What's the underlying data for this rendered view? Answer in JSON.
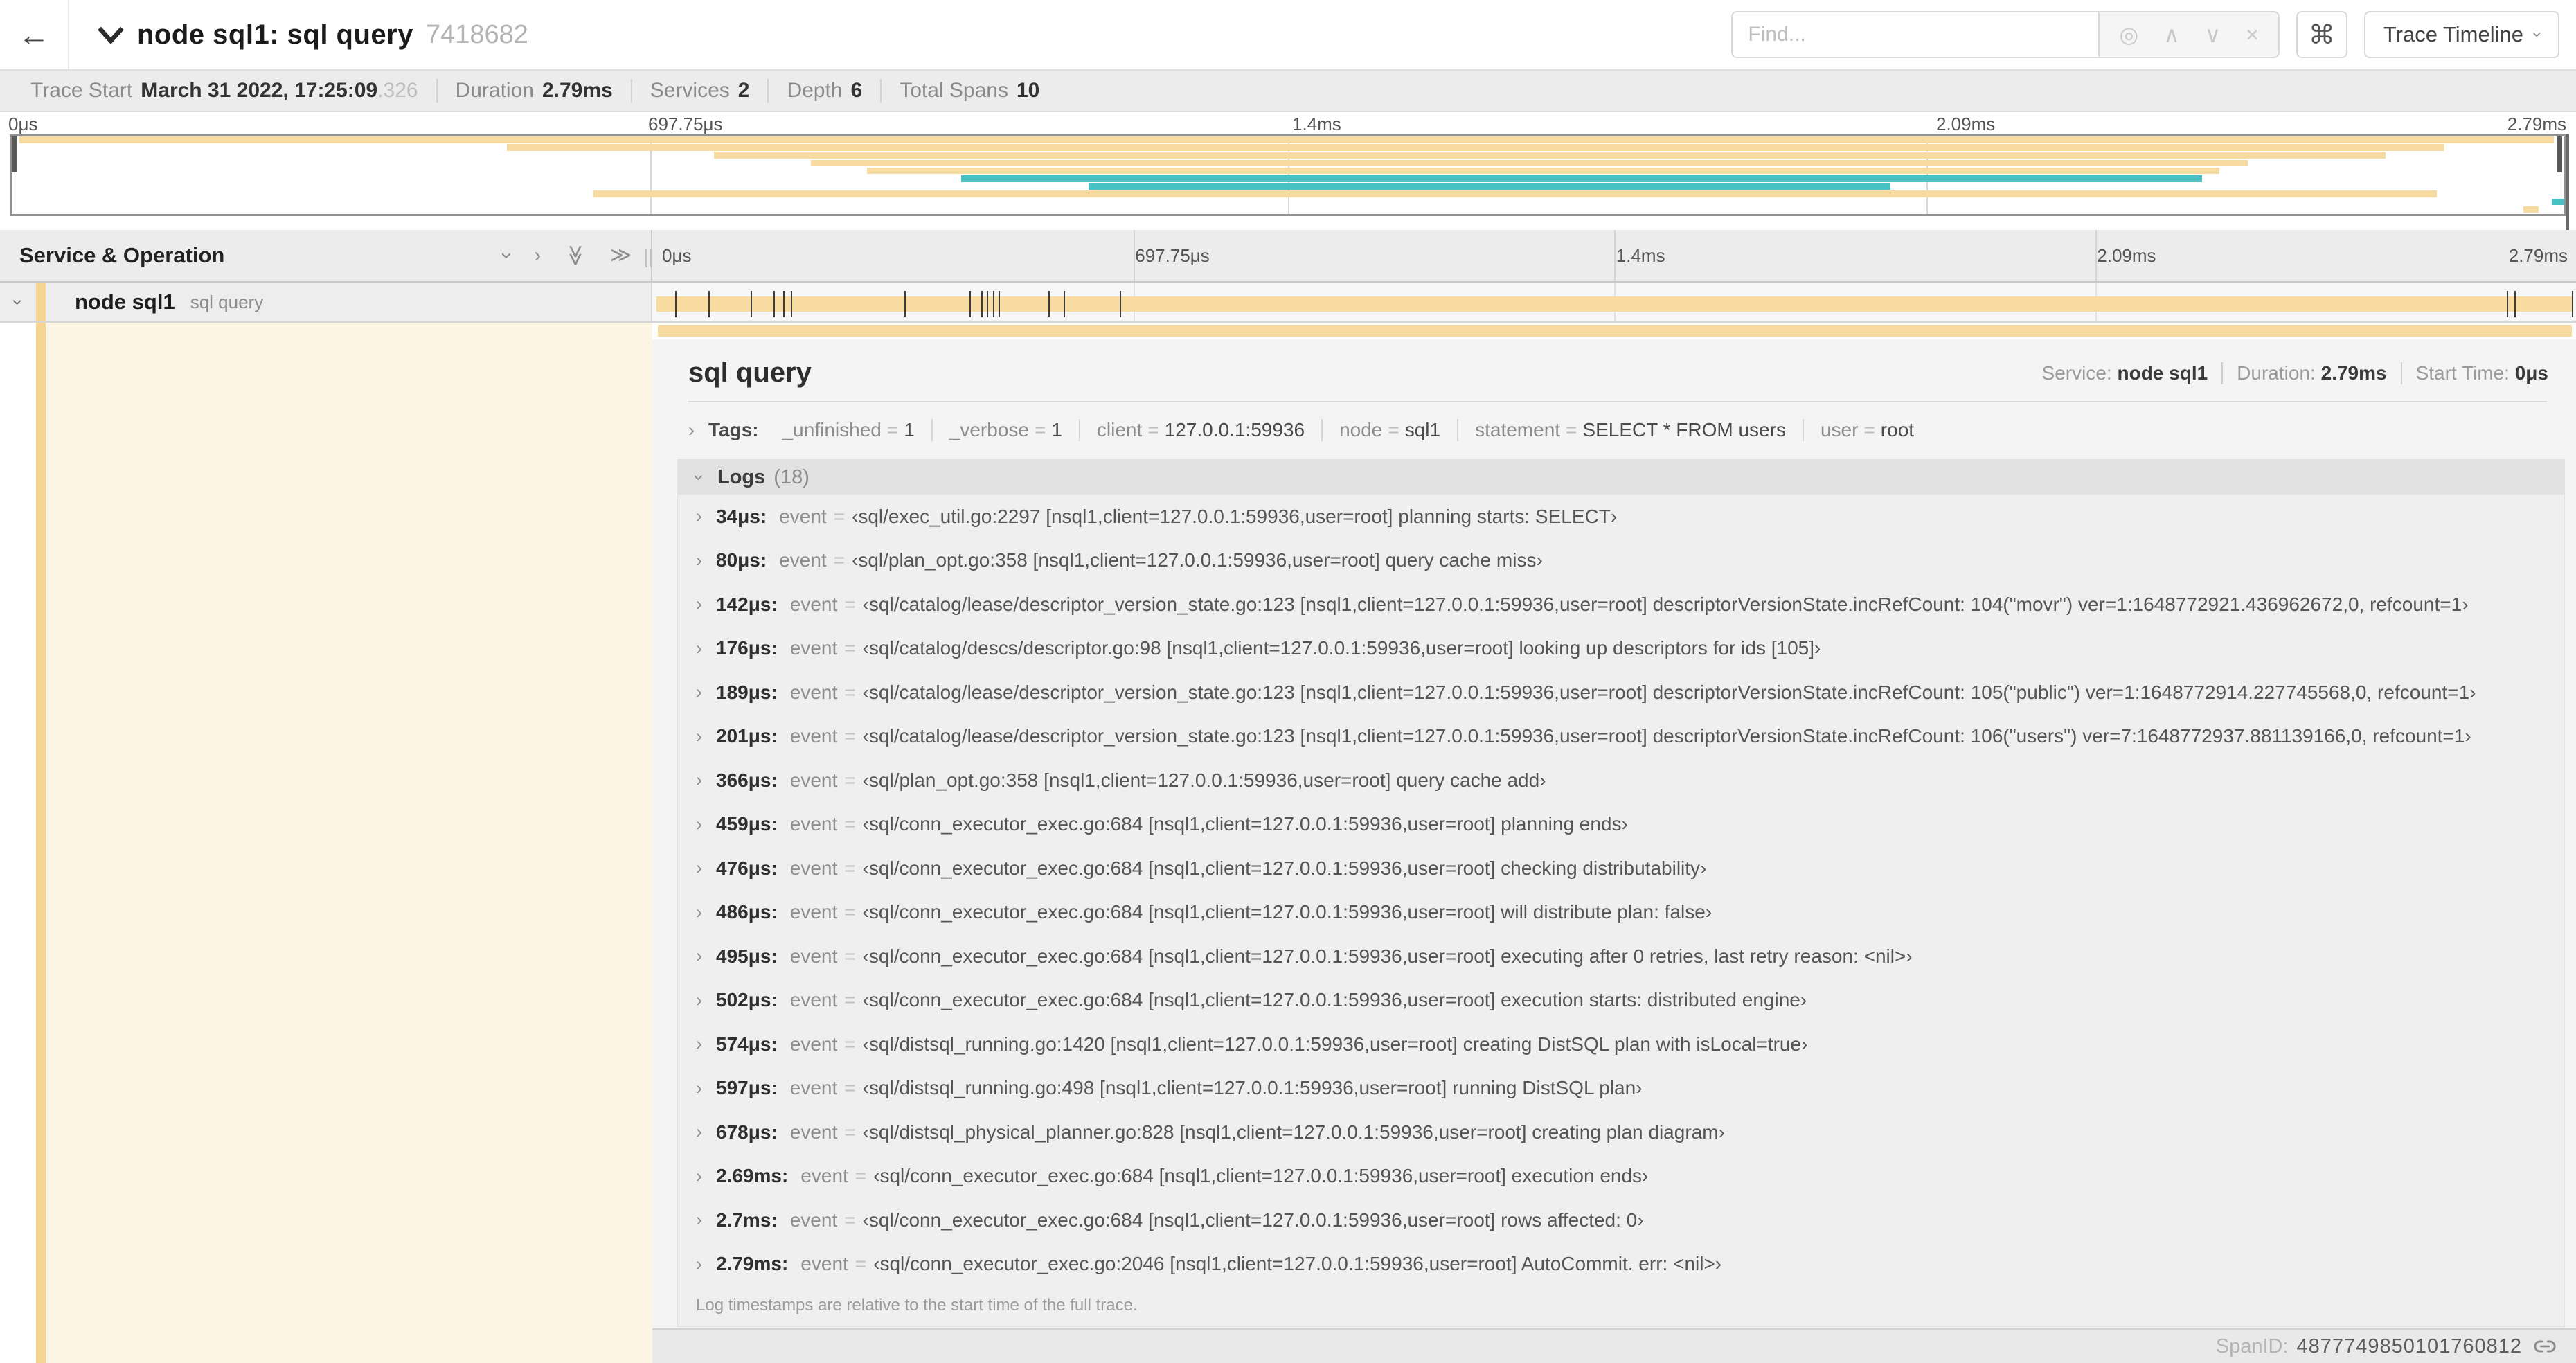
{
  "icons": {
    "back": "←",
    "chevron_right": "›",
    "locate": "◎",
    "prev": "∧",
    "next": "∨",
    "clear": "×",
    "shortcut": "⌘",
    "double_chevron": "≫"
  },
  "header": {
    "title": "node sql1: sql query",
    "trace_id": "7418682",
    "find_placeholder": "Find...",
    "view_dropdown": "Trace Timeline"
  },
  "summary": {
    "items": [
      {
        "label": "Trace Start",
        "value": "March 31 2022, 17:25:09",
        "suffix": ".326"
      },
      {
        "label": "Duration",
        "value": "2.79ms",
        "suffix": ""
      },
      {
        "label": "Services",
        "value": "2",
        "suffix": ""
      },
      {
        "label": "Depth",
        "value": "6",
        "suffix": ""
      },
      {
        "label": "Total Spans",
        "value": "10",
        "suffix": ""
      }
    ]
  },
  "colors": {
    "span_yellow": "#f7dba1",
    "span_teal": "#47c1c1",
    "stripe_yellow": "#f5d591",
    "cream": "#fcf5e3"
  },
  "minimap": {
    "axis_labels": [
      "0μs",
      "697.75μs",
      "1.4ms",
      "2.09ms",
      "2.79ms"
    ],
    "spans": [
      {
        "top": "0%",
        "left": "0.3%",
        "width": "99.3%",
        "color": "#f7dba1"
      },
      {
        "top": "10%",
        "left": "19.4%",
        "width": "75.9%",
        "color": "#f7dba1"
      },
      {
        "top": "20%",
        "left": "27.5%",
        "width": "65.5%",
        "color": "#f7dba1"
      },
      {
        "top": "30%",
        "left": "31.3%",
        "width": "56.3%",
        "color": "#f7dba1"
      },
      {
        "top": "40%",
        "left": "33.5%",
        "width": "53.0%",
        "color": "#f7dba1"
      },
      {
        "top": "50%",
        "left": "37.2%",
        "width": "48.6%",
        "color": "#47c1c1"
      },
      {
        "top": "60%",
        "left": "42.2%",
        "width": "31.4%",
        "color": "#47c1c1"
      },
      {
        "top": "70%",
        "left": "22.8%",
        "width": "72.2%",
        "color": "#f7dba1"
      },
      {
        "top": "80%",
        "left": "99.5%",
        "width": "0.5%",
        "color": "#47c1c1"
      },
      {
        "top": "90%",
        "left": "98.4%",
        "width": "0.6%",
        "color": "#f7dba1"
      }
    ]
  },
  "timeline": {
    "column_header": "Service & Operation",
    "ruler_labels": [
      "0μs",
      "697.75μs",
      "1.4ms",
      "2.09ms",
      "2.79ms"
    ],
    "row": {
      "service": "node sql1",
      "operation": "sql query"
    },
    "ticks": [
      "1.2%",
      "2.9%",
      "5.1%",
      "6.3%",
      "6.8%",
      "7.2%",
      "13.1%",
      "16.5%",
      "17.1%",
      "17.4%",
      "17.7%",
      "18%",
      "20.6%",
      "21.4%",
      "24.3%",
      "96.4%",
      "96.8%",
      "99.8%"
    ]
  },
  "detail": {
    "title": "sql query",
    "meta": {
      "service_label": "Service:",
      "service": "node sql1",
      "duration_label": "Duration:",
      "duration": "2.79ms",
      "start_label": "Start Time:",
      "start": "0μs"
    },
    "tags": {
      "label": "Tags:",
      "eq": "=",
      "items": [
        {
          "k": "_unfinished",
          "v": "1"
        },
        {
          "k": "_verbose",
          "v": "1"
        },
        {
          "k": "client",
          "v": "127.0.0.1:59936"
        },
        {
          "k": "node",
          "v": "sql1"
        },
        {
          "k": "statement",
          "v": "SELECT * FROM users"
        },
        {
          "k": "user",
          "v": "root"
        }
      ]
    },
    "logs": {
      "label": "Logs",
      "count": "(18)",
      "field_label": "event",
      "eq": "=",
      "entries": [
        {
          "t": "34μs:",
          "msg": "‹sql/exec_util.go:2297 [nsql1,client=127.0.0.1:59936,user=root] planning starts: SELECT›"
        },
        {
          "t": "80μs:",
          "msg": "‹sql/plan_opt.go:358 [nsql1,client=127.0.0.1:59936,user=root] query cache miss›"
        },
        {
          "t": "142μs:",
          "msg": "‹sql/catalog/lease/descriptor_version_state.go:123 [nsql1,client=127.0.0.1:59936,user=root] descriptorVersionState.incRefCount: 104(\"movr\") ver=1:1648772921.436962672,0, refcount=1›"
        },
        {
          "t": "176μs:",
          "msg": "‹sql/catalog/descs/descriptor.go:98 [nsql1,client=127.0.0.1:59936,user=root] looking up descriptors for ids [105]›"
        },
        {
          "t": "189μs:",
          "msg": "‹sql/catalog/lease/descriptor_version_state.go:123 [nsql1,client=127.0.0.1:59936,user=root] descriptorVersionState.incRefCount: 105(\"public\") ver=1:1648772914.227745568,0, refcount=1›"
        },
        {
          "t": "201μs:",
          "msg": "‹sql/catalog/lease/descriptor_version_state.go:123 [nsql1,client=127.0.0.1:59936,user=root] descriptorVersionState.incRefCount: 106(\"users\") ver=7:1648772937.881139166,0, refcount=1›"
        },
        {
          "t": "366μs:",
          "msg": "‹sql/plan_opt.go:358 [nsql1,client=127.0.0.1:59936,user=root] query cache add›"
        },
        {
          "t": "459μs:",
          "msg": "‹sql/conn_executor_exec.go:684 [nsql1,client=127.0.0.1:59936,user=root] planning ends›"
        },
        {
          "t": "476μs:",
          "msg": "‹sql/conn_executor_exec.go:684 [nsql1,client=127.0.0.1:59936,user=root] checking distributability›"
        },
        {
          "t": "486μs:",
          "msg": "‹sql/conn_executor_exec.go:684 [nsql1,client=127.0.0.1:59936,user=root] will distribute plan: false›"
        },
        {
          "t": "495μs:",
          "msg": "‹sql/conn_executor_exec.go:684 [nsql1,client=127.0.0.1:59936,user=root] executing after 0 retries, last retry reason: <nil>›"
        },
        {
          "t": "502μs:",
          "msg": "‹sql/conn_executor_exec.go:684 [nsql1,client=127.0.0.1:59936,user=root] execution starts: distributed engine›"
        },
        {
          "t": "574μs:",
          "msg": "‹sql/distsql_running.go:1420 [nsql1,client=127.0.0.1:59936,user=root] creating DistSQL plan with isLocal=true›"
        },
        {
          "t": "597μs:",
          "msg": "‹sql/distsql_running.go:498 [nsql1,client=127.0.0.1:59936,user=root] running DistSQL plan›"
        },
        {
          "t": "678μs:",
          "msg": "‹sql/distsql_physical_planner.go:828 [nsql1,client=127.0.0.1:59936,user=root] creating plan diagram›"
        },
        {
          "t": "2.69ms:",
          "msg": "‹sql/conn_executor_exec.go:684 [nsql1,client=127.0.0.1:59936,user=root] execution ends›"
        },
        {
          "t": "2.7ms:",
          "msg": "‹sql/conn_executor_exec.go:684 [nsql1,client=127.0.0.1:59936,user=root] rows affected: 0›"
        },
        {
          "t": "2.79ms:",
          "msg": "‹sql/conn_executor_exec.go:2046 [nsql1,client=127.0.0.1:59936,user=root] AutoCommit. err: <nil>›"
        }
      ],
      "note": "Log timestamps are relative to the start time of the full trace."
    },
    "footer": {
      "label": "SpanID:",
      "value": "4877749850101760812"
    }
  }
}
